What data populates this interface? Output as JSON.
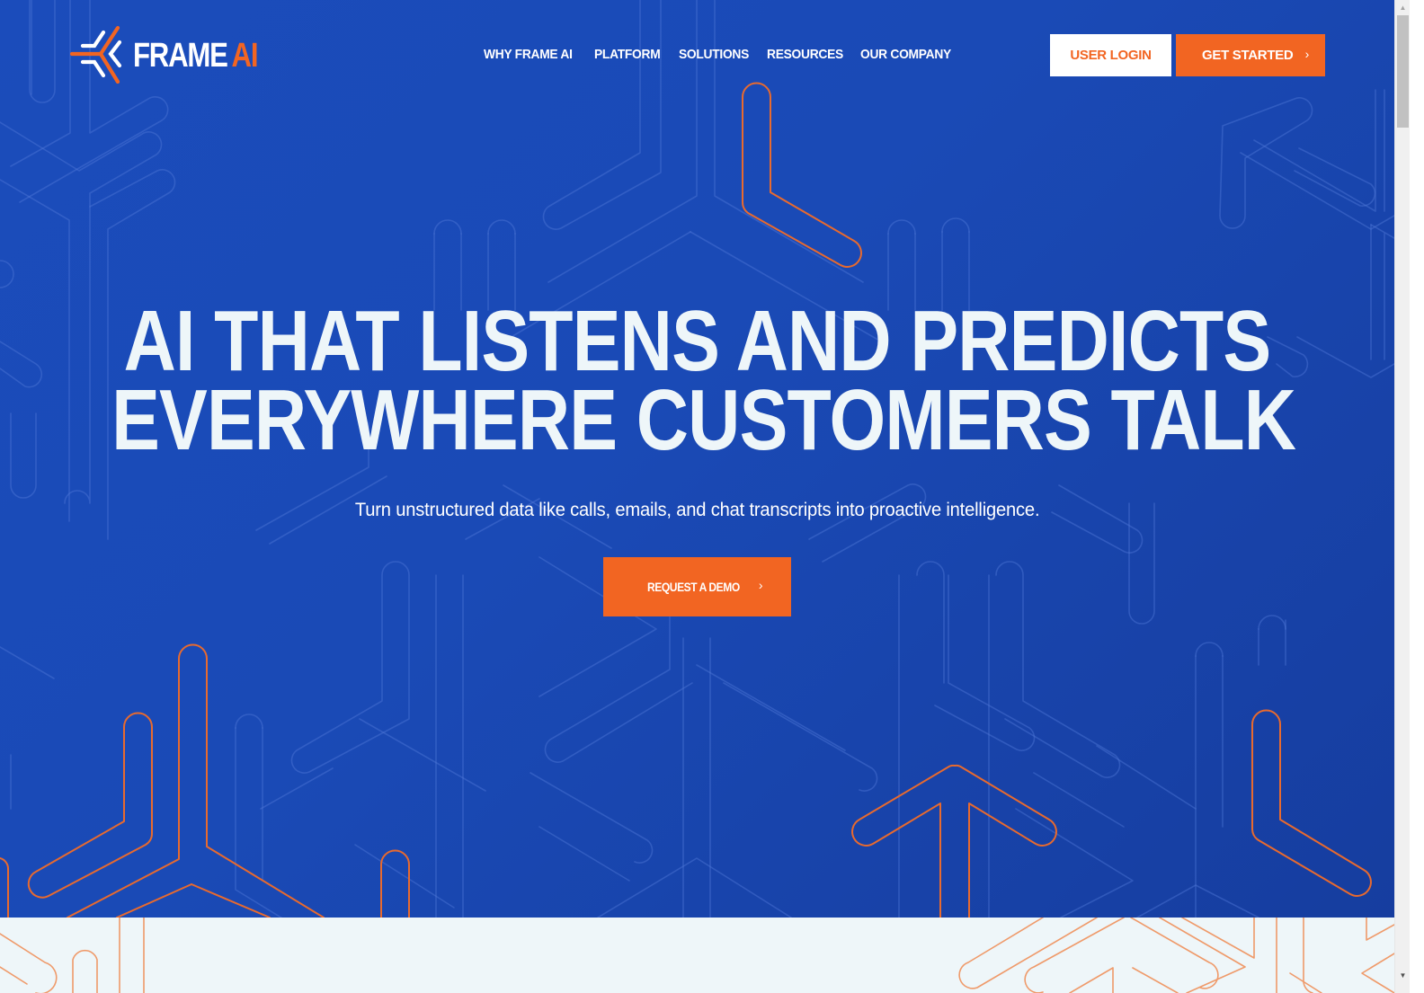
{
  "brand": {
    "name_main": "FRAME",
    "name_accent": "AI",
    "logo_icon": "frame-ai-logo-mark"
  },
  "nav": {
    "items": [
      {
        "label": "WHY FRAME AI"
      },
      {
        "label": "PLATFORM"
      },
      {
        "label": "SOLUTIONS"
      },
      {
        "label": "RESOURCES"
      },
      {
        "label": "OUR COMPANY"
      }
    ]
  },
  "header_actions": {
    "login_label": "USER LOGIN",
    "get_started_label": "GET STARTED",
    "get_started_icon": "chevron-right-icon"
  },
  "hero": {
    "headline_line1": "AI THAT LISTENS AND PREDICTS",
    "headline_line2": "EVERYWHERE CUSTOMERS TALK",
    "subheadline": "Turn unstructured data like calls, emails, and chat transcripts into proactive intelligence.",
    "cta_label": "REQUEST A DEMO",
    "cta_icon": "chevron-right-icon"
  },
  "icons": {
    "chevron_right": "›",
    "scroll_up": "▲",
    "scroll_down": "▼"
  },
  "colors": {
    "primary_blue": "#1a4ab6",
    "accent_orange": "#f26522",
    "light_bg": "#eef6f9",
    "headline_text": "#eef6f9"
  }
}
